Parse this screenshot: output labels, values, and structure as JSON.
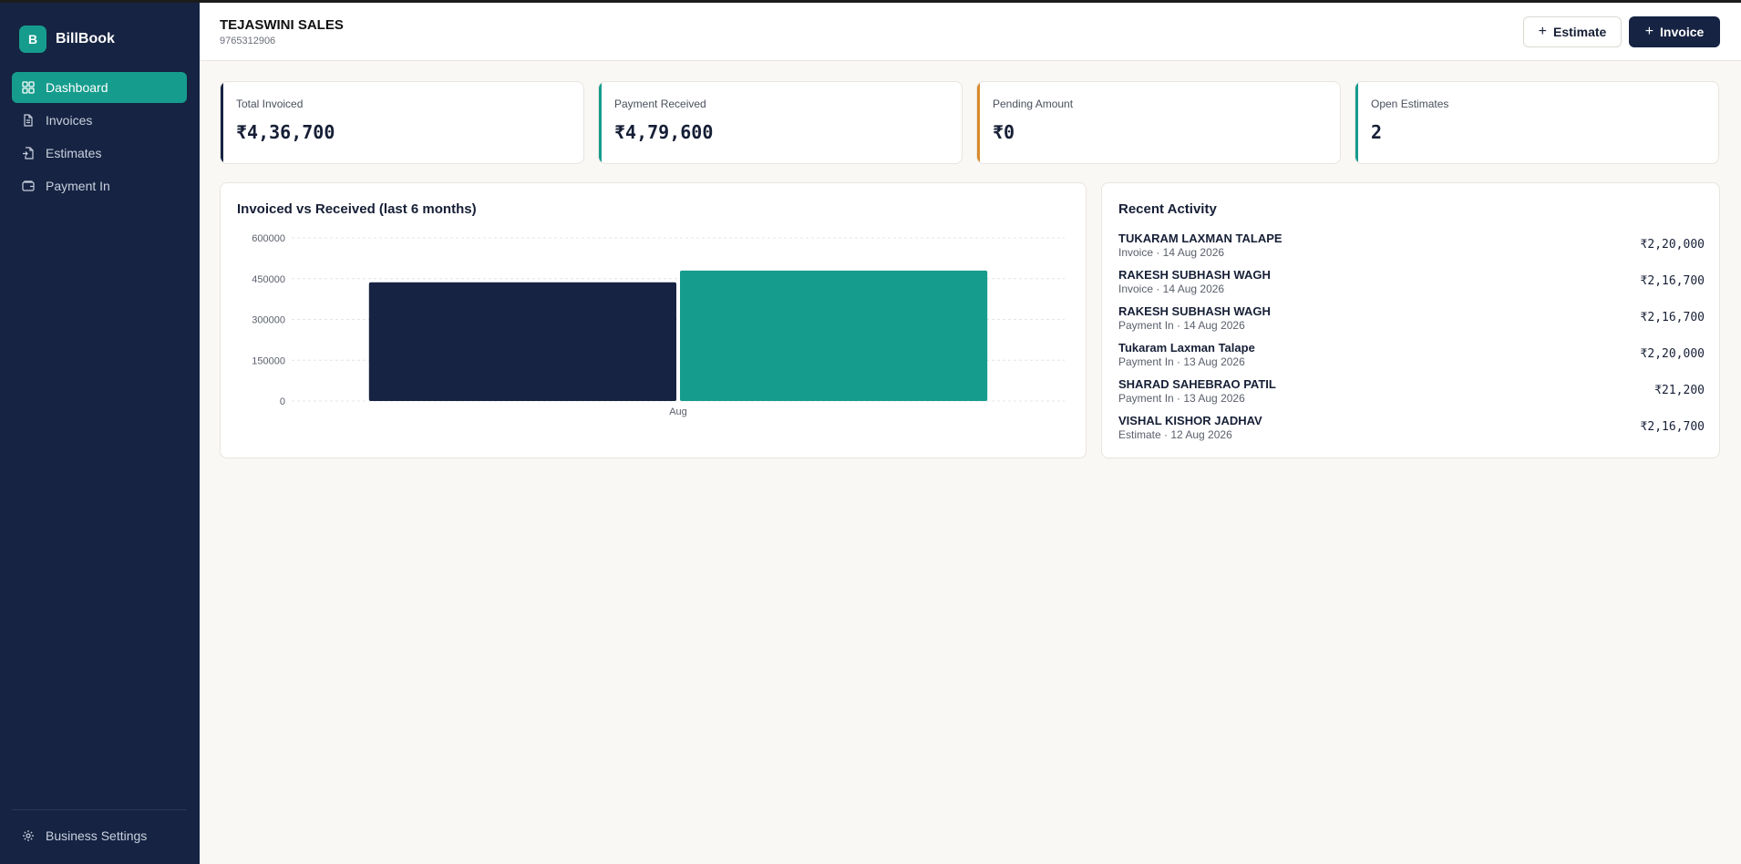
{
  "brand": {
    "logo_letter": "B",
    "name": "BillBook"
  },
  "sidebar": {
    "items": [
      {
        "label": "Dashboard",
        "icon": "dashboard-icon",
        "active": true
      },
      {
        "label": "Invoices",
        "icon": "file-icon",
        "active": false
      },
      {
        "label": "Estimates",
        "icon": "file-import-icon",
        "active": false
      },
      {
        "label": "Payment In",
        "icon": "wallet-icon",
        "active": false
      }
    ],
    "settings_label": "Business Settings"
  },
  "header": {
    "business_name": "TEJASWINI SALES",
    "phone": "9765312906",
    "estimate_label": "Estimate",
    "invoice_label": "Invoice"
  },
  "stats": [
    {
      "label": "Total Invoiced",
      "value": "₹4,36,700",
      "accent": "#162342"
    },
    {
      "label": "Payment Received",
      "value": "₹4,79,600",
      "accent": "#169c8d"
    },
    {
      "label": "Pending Amount",
      "value": "₹0",
      "accent": "#d98a2b"
    },
    {
      "label": "Open Estimates",
      "value": "2",
      "accent": "#169c8d"
    }
  ],
  "chart_title": "Invoiced vs Received (last 6 months)",
  "chart_data": {
    "type": "bar",
    "categories": [
      "Aug"
    ],
    "series": [
      {
        "values": [
          436700
        ],
        "color": "#162342"
      },
      {
        "values": [
          479600
        ],
        "color": "#169c8d"
      }
    ],
    "yticks": [
      "0",
      "150000",
      "300000",
      "450000",
      "600000"
    ],
    "ylim": [
      0,
      600000
    ],
    "grid": true
  },
  "activity": {
    "title": "Recent Activity",
    "items": [
      {
        "name": "TUKARAM LAXMAN TALAPE",
        "meta": "Invoice · 14 Aug 2026",
        "amount": "₹2,20,000"
      },
      {
        "name": "RAKESH SUBHASH WAGH",
        "meta": "Invoice · 14 Aug 2026",
        "amount": "₹2,16,700"
      },
      {
        "name": "RAKESH SUBHASH WAGH",
        "meta": "Payment In · 14 Aug 2026",
        "amount": "₹2,16,700"
      },
      {
        "name": "Tukaram Laxman Talape",
        "meta": "Payment In · 13 Aug 2026",
        "amount": "₹2,20,000"
      },
      {
        "name": "SHARAD SAHEBRAO PATIL",
        "meta": "Payment In · 13 Aug 2026",
        "amount": "₹21,200"
      },
      {
        "name": "VISHAL KISHOR JADHAV",
        "meta": "Estimate · 12 Aug 2026",
        "amount": "₹2,16,700"
      }
    ]
  }
}
